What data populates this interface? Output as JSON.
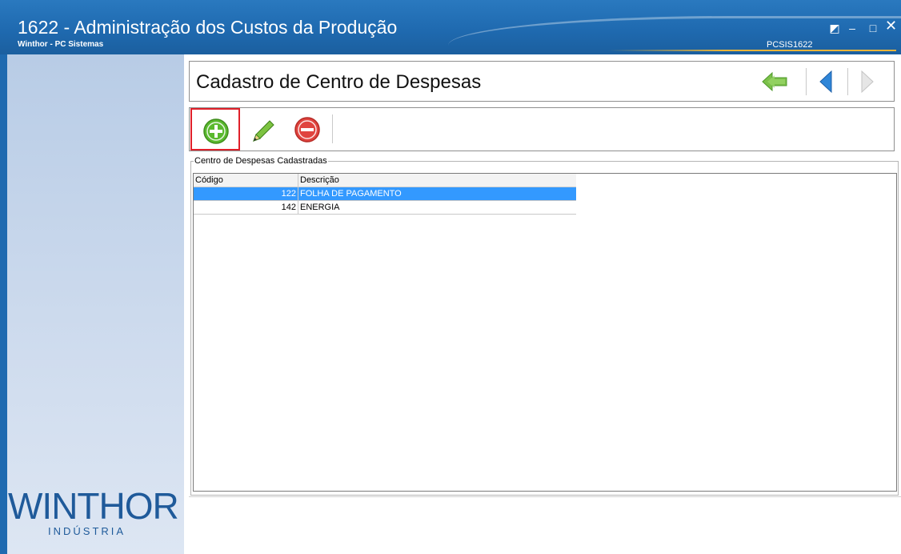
{
  "window": {
    "title": "1622 - Administração dos Custos da Produção",
    "subtitle": "Winthor - PC Sistemas",
    "code": "PCSIS1622",
    "controls": {
      "restore": "◩",
      "minimize": "–",
      "maximize": "□",
      "close": "✕"
    }
  },
  "brand": {
    "name": "WINTHOR",
    "sub": "INDÚSTRIA"
  },
  "header": {
    "title": "Cadastro de Centro de Despesas",
    "nav": [
      "exit-arrow-icon",
      "previous-arrow-icon",
      "next-arrow-icon"
    ]
  },
  "toolbar": {
    "buttons": [
      "add-icon",
      "edit-pencil-icon",
      "delete-icon"
    ]
  },
  "group": {
    "label": "Centro de Despesas Cadastradas",
    "columns": [
      "Código",
      "Descrição"
    ],
    "rows": [
      {
        "code": "122",
        "description": "FOLHA DE PAGAMENTO",
        "selected": true
      },
      {
        "code": "142",
        "description": "ENERGIA",
        "selected": false
      }
    ]
  },
  "colors": {
    "titlebar": "#1f6ab0",
    "selection": "#3399ff",
    "add_green": "#5ab92e",
    "delete_red": "#e0443f",
    "highlight_border": "#e0202a"
  }
}
